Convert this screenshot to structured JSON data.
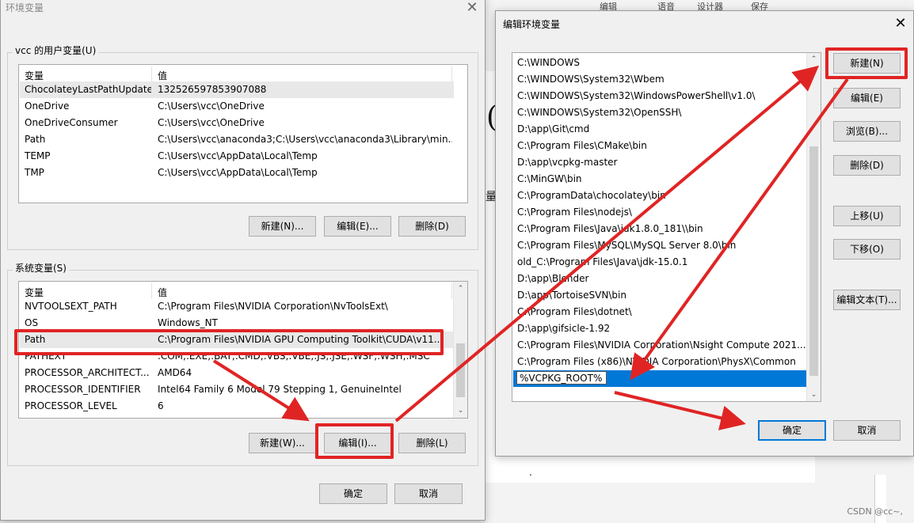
{
  "background": {
    "tabs": [
      "编辑",
      "语音",
      "设计器",
      "保存"
    ],
    "chars": [
      "(",
      "量",
      "."
    ],
    "watermark": "CSDN @cc~,"
  },
  "env_dialog": {
    "title": "环境变量",
    "user_group": "vcc 的用户变量(U)",
    "system_group": "系统变量(S)",
    "columns": [
      "变量",
      "值"
    ],
    "user_vars": [
      {
        "name": "ChocolateyLastPathUpdate",
        "value": "132526597853907088"
      },
      {
        "name": "OneDrive",
        "value": "C:\\Users\\vcc\\OneDrive"
      },
      {
        "name": "OneDriveConsumer",
        "value": "C:\\Users\\vcc\\OneDrive"
      },
      {
        "name": "Path",
        "value": "C:\\Users\\vcc\\anaconda3;C:\\Users\\vcc\\anaconda3\\Library\\min..."
      },
      {
        "name": "TEMP",
        "value": "C:\\Users\\vcc\\AppData\\Local\\Temp"
      },
      {
        "name": "TMP",
        "value": "C:\\Users\\vcc\\AppData\\Local\\Temp"
      }
    ],
    "system_vars": [
      {
        "name": "NVTOOLSEXT_PATH",
        "value": "C:\\Program Files\\NVIDIA Corporation\\NvToolsExt\\"
      },
      {
        "name": "OS",
        "value": "Windows_NT"
      },
      {
        "name": "Path",
        "value": "C:\\Program Files\\NVIDIA GPU Computing Toolkit\\CUDA\\v11..."
      },
      {
        "name": "PATHEXT",
        "value": ".COM;.EXE;.BAT;.CMD;.VBS;.VBE;.JS;.JSE;.WSF;.WSH;.MSC"
      },
      {
        "name": "PROCESSOR_ARCHITECT...",
        "value": "AMD64"
      },
      {
        "name": "PROCESSOR_IDENTIFIER",
        "value": "Intel64 Family 6 Model 79 Stepping 1, GenuineIntel"
      },
      {
        "name": "PROCESSOR_LEVEL",
        "value": "6"
      }
    ],
    "user_buttons": {
      "new": "新建(N)...",
      "edit": "编辑(E)...",
      "delete": "删除(D)"
    },
    "system_buttons": {
      "new": "新建(W)...",
      "edit": "编辑(I)...",
      "delete": "删除(L)"
    },
    "ok": "确定",
    "cancel": "取消"
  },
  "edit_dialog": {
    "title": "编辑环境变量",
    "paths": [
      "C:\\WINDOWS",
      "C:\\WINDOWS\\System32\\Wbem",
      "C:\\WINDOWS\\System32\\WindowsPowerShell\\v1.0\\",
      "C:\\WINDOWS\\System32\\OpenSSH\\",
      "D:\\app\\Git\\cmd",
      "C:\\Program Files\\CMake\\bin",
      "D:\\app\\vcpkg-master",
      "C:\\MinGW\\bin",
      "C:\\ProgramData\\chocolatey\\bin",
      "C:\\Program Files\\nodejs\\",
      "C:\\Program Files\\Java\\jdk1.8.0_181\\\\bin",
      "C:\\Program Files\\MySQL\\MySQL Server 8.0\\bin",
      "old_C:\\Program Files\\Java\\jdk-15.0.1",
      "D:\\app\\Blender",
      "D:\\app\\TortoiseSVN\\bin",
      "C:\\Program Files\\dotnet\\",
      "D:\\app\\gifsicle-1.92",
      "C:\\Program Files\\NVIDIA Corporation\\Nsight Compute 2021....",
      "C:\\Program Files (x86)\\NVIDIA Corporation\\PhysX\\Common"
    ],
    "new_entry": "%VCPKG_ROOT%",
    "buttons": {
      "new": "新建(N)",
      "edit": "编辑(E)",
      "browse": "浏览(B)...",
      "delete": "删除(D)",
      "up": "上移(U)",
      "down": "下移(O)",
      "edit_text": "编辑文本(T)..."
    },
    "ok": "确定",
    "cancel": "取消"
  },
  "colors": {
    "highlight": "#e02424",
    "selection": "#0078d7"
  }
}
